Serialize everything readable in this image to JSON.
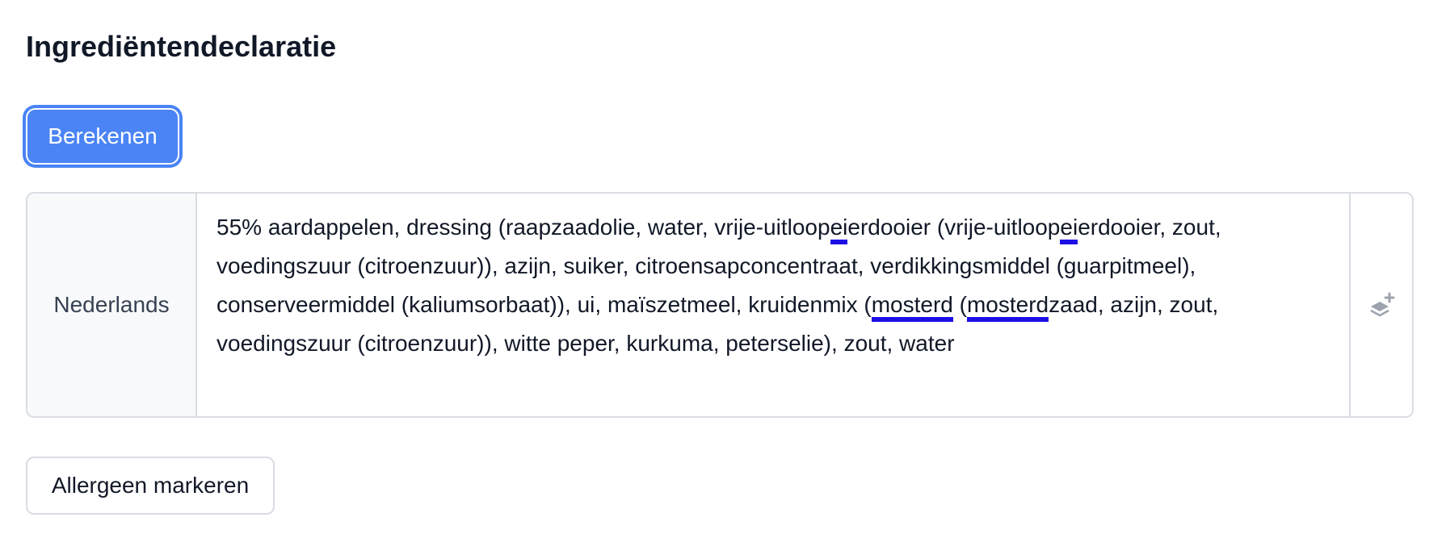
{
  "section": {
    "title": "Ingrediëntendeclaratie"
  },
  "actions": {
    "calculate_label": "Berekenen",
    "mark_allergen_label": "Allergeen markeren"
  },
  "declaration": {
    "language": "Nederlands",
    "segments": [
      "55% aardappelen, dressing (raapzaadolie, water, vrije-uitloop",
      "ei",
      "erdooier (vrije-uitloop",
      "ei",
      "erdooier, zout, voedingszuur (citroenzuur)), azijn, suiker, citroensapconcentraat, verdikkingsmiddel (guarpitmeel), conserveermiddel (kaliumsorbaat)), ui, maïszetmeel, kruidenmix (",
      "mosterd",
      " (",
      "mosterd",
      "zaad, azijn, zout, voedingszuur (citroenzuur)), witte peper, kurkuma, peterselie), zout, water"
    ],
    "allergen_highlight_color": "#1c0fe6",
    "action_icon": "layers-plus-icon"
  },
  "colors": {
    "primary_button": "#4a84f5",
    "border": "#d9dde3",
    "label_background": "#f8f9fb"
  }
}
